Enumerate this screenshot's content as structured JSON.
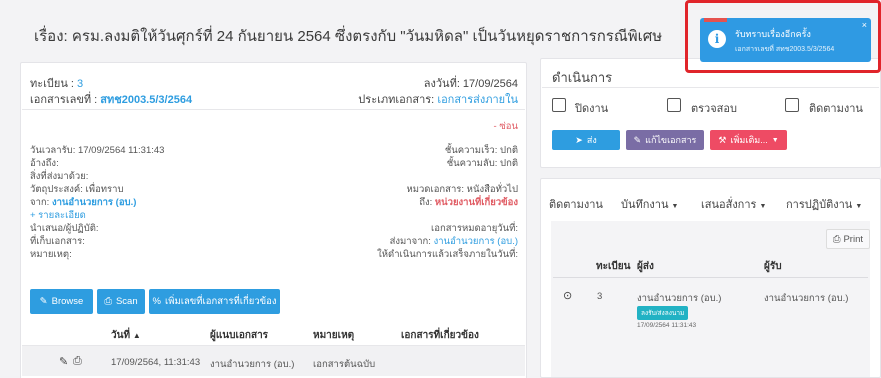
{
  "page_title": "เรื่อง: ครม.ลงมติให้วันศุกร์ที่ 24 กันยายน 2564 ซึ่งตรงกับ \"วันมหิดล\" เป็นวันหยุดราชการกรณีพิเศษ",
  "doc": {
    "reg_label": "ทะเบียน :",
    "reg_value": "3",
    "docno_label": "เอกสารเลขที่ :",
    "docno_value": "สทช2003.5/3/2564",
    "date_line": "ลงวันที่: 17/09/2564",
    "type_label": "ประเภทเอกสาร:",
    "type_value": "เอกสารส่งภายใน",
    "hide_link": "- ซ่อน",
    "received": "วันเวลารับ: 17/09/2564 11:31:43",
    "speed": "ชั้นความเร็ว: ปกติ",
    "ref": "อ้างถึง:",
    "secret": "ชั้นความลับ: ปกติ",
    "attach": "สิ่งที่ส่งมาด้วย:",
    "purpose": "วัตถุประสงค์: เพื่อทราบ",
    "category": "หมวดเอกสาร: หนังสือทั่วไป",
    "from_label": "จาก:",
    "from_value": "งานอำนวยการ (อบ.)",
    "to_label": "ถึง:",
    "to_value": "หน่วยงานที่เกี่ยวข้อง",
    "details_link": "+ รายละเอียด",
    "proposer": "นำเสนอ/ผู้ปฏิบัติ:",
    "expiry": "เอกสารหมดอายุวันที่:",
    "storage": "ที่เก็บเอกสาร:",
    "sentby_label": "ส่งมาจาก:",
    "sentby_value": "งานอำนวยการ (อบ.)",
    "note": "หมายเหตุ:",
    "deadline": "ให้ดำเนินการแล้วเสร็จภายในวันที่:"
  },
  "buttons": {
    "browse": "Browse",
    "scan": "Scan",
    "add_related": "เพิ่มเลขที่เอกสารที่เกี่ยวข้อง"
  },
  "attachments_table": {
    "headers": [
      "วันที่",
      "ผู้แนบเอกสาร",
      "หมายเหตุ",
      "เอกสารที่เกี่ยวข้อง"
    ],
    "sort_indicator": "▲",
    "rows": [
      {
        "date": "17/09/2564, 11:31:43",
        "uploader": "งานอำนวยการ (อบ.)",
        "note": "เอกสารต้นฉบับ"
      }
    ]
  },
  "action_panel": {
    "title": "ดำเนินการ",
    "checkboxes": [
      "ปิดงาน",
      "ตรวจสอบ",
      "ติดตามงาน"
    ],
    "send": "ส่ง",
    "edit": "แก้ไขเอกสาร",
    "more": "เพิ่มเติม..."
  },
  "tracking": {
    "tabs": [
      "ติดตามงาน",
      "บันทึกงาน",
      "เสนอสั่งการ",
      "การปฏิบัติงาน"
    ],
    "print": "Print",
    "headers": [
      "ทะเบียน",
      "ผู้ส่ง",
      "ผู้รับ"
    ],
    "row": {
      "reg": "3",
      "sender": "งานอำนวยการ (อบ.)",
      "tag": "ลงรับ/ส่งลงนาม",
      "time": "17/09/2564 11:31:43",
      "receiver": "งานอำนวยการ (อบ.)"
    }
  },
  "toast": {
    "title": "รับทราบเรื่องอีกครั้ง",
    "subtitle": "เอกสารเลขที่ สทช2003.5/3/2564",
    "close": "×"
  },
  "colors": {
    "accent": "#2e9de0",
    "purple": "#7a6da5",
    "danger": "#ee4b64",
    "highlight": "#e0242a",
    "tag": "#22b2c4"
  }
}
